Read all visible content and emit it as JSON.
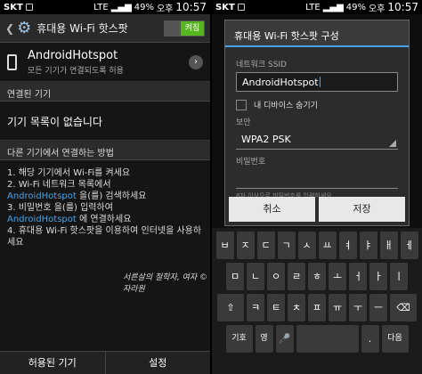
{
  "status_left": {
    "carrier": "SKT",
    "network": "LTE",
    "battery": "49%",
    "time_prefix": "오후",
    "time": "10:57"
  },
  "status_right": {
    "carrier": "SKT",
    "network": "LTE",
    "battery": "49%",
    "time_prefix": "오후",
    "time": "10:57"
  },
  "left": {
    "title": "휴대용 Wi-Fi 핫스팟",
    "toggle_label": "켜짐",
    "hotspot_name": "AndroidHotspot",
    "hotspot_sub": "모든 기기가 연결되도록 허용",
    "connected_header": "연결된 기기",
    "no_devices": "기기 목록이 없습니다",
    "other_header": "다른 기기에서 연결하는 방법",
    "step1": "1. 해당 기기에서 Wi-Fi를 켜세요",
    "step2": "2. Wi-Fi 네트워크 목록에서",
    "step2_name": "AndroidHotspot",
    "step2_suffix": "을(를) 검색하세요",
    "step3_prefix": "3. 비밀번호",
    "step3_suffix": "을(를) 입력하여",
    "step3b_name": "AndroidHotspot",
    "step3b_suffix": "에 연결하세요",
    "step4": "4. 휴대용 Wi-Fi 핫스팟을 이용하여 인터넷을 사용하세요",
    "bottom_left": "허용된 기기",
    "bottom_right": "설정",
    "watermark": "서른살의 철학자, 여자 © 자라원"
  },
  "dialog": {
    "title": "휴대용 Wi-Fi 핫스팟 구성",
    "ssid_label": "네트워크 SSID",
    "ssid_value": "AndroidHotspot",
    "hide_label": "내 디바이스 숨기기",
    "security_label": "보안",
    "security_value": "WPA2 PSK",
    "password_label": "비밀번호",
    "hint": "8자 이상으로 비밀번호를 입력하세요",
    "cancel": "취소",
    "save": "저장"
  },
  "keyboard": {
    "row1": [
      "ㅂ",
      "ㅈ",
      "ㄷ",
      "ㄱ",
      "ㅅ",
      "ㅛ",
      "ㅕ",
      "ㅑ",
      "ㅐ",
      "ㅔ"
    ],
    "row2": [
      "ㅁ",
      "ㄴ",
      "ㅇ",
      "ㄹ",
      "ㅎ",
      "ㅗ",
      "ㅓ",
      "ㅏ",
      "ㅣ"
    ],
    "row3": [
      "⇧",
      "ㅋ",
      "ㅌ",
      "ㅊ",
      "ㅍ",
      "ㅠ",
      "ㅜ",
      "ㅡ",
      "⌫"
    ],
    "sym": "기호",
    "lang": "영",
    "next": "다음"
  }
}
